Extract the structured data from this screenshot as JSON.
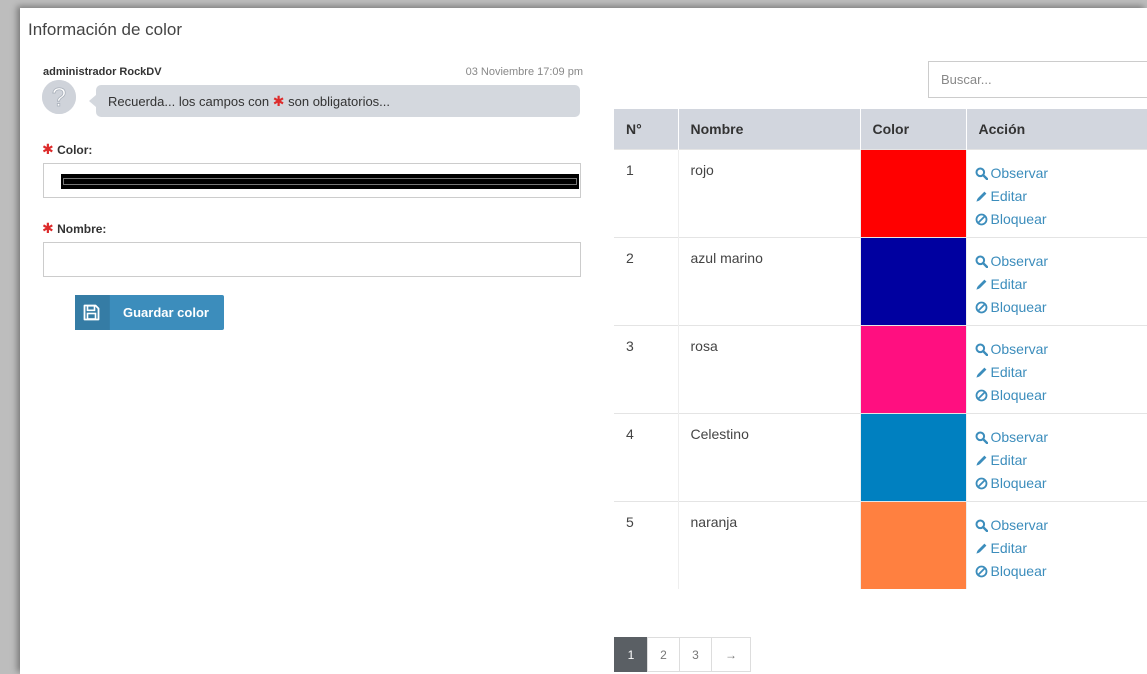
{
  "panel": {
    "title": "Información de color"
  },
  "message": {
    "author": "administrador RockDV",
    "timestamp": "03 Noviembre 17:09 pm",
    "text_before": "Recuerda... los campos con",
    "text_after": "son obligatorios..."
  },
  "required_mark": "✱",
  "form": {
    "color_label": "Color:",
    "color_value": "#000000",
    "nombre_label": "Nombre:",
    "nombre_value": "",
    "save_label": "Guardar color"
  },
  "search": {
    "placeholder": "Buscar..."
  },
  "table": {
    "headers": [
      "N°",
      "Nombre",
      "Color",
      "Acción"
    ],
    "actions": {
      "view": "Observar",
      "edit": "Editar",
      "block": "Bloquear"
    },
    "rows": [
      {
        "n": "1",
        "nombre": "rojo",
        "color": "#ff0000"
      },
      {
        "n": "2",
        "nombre": "azul marino",
        "color": "#0000a0"
      },
      {
        "n": "3",
        "nombre": "rosa",
        "color": "#ff0f80"
      },
      {
        "n": "4",
        "nombre": "Celestino",
        "color": "#0080c0"
      },
      {
        "n": "5",
        "nombre": "naranja",
        "color": "#ff8040"
      }
    ]
  },
  "pagination": {
    "pages": [
      "1",
      "2",
      "3"
    ],
    "active": "1",
    "next": "→"
  },
  "colors": {
    "accent": "#3c8dbc",
    "required": "#dd2b2b",
    "header_bg": "#d2d6de"
  },
  "icons": {
    "avatar": "question-mark-icon",
    "save": "floppy-disk-icon",
    "view": "search-icon",
    "edit": "pencil-icon",
    "block": "ban-icon"
  }
}
